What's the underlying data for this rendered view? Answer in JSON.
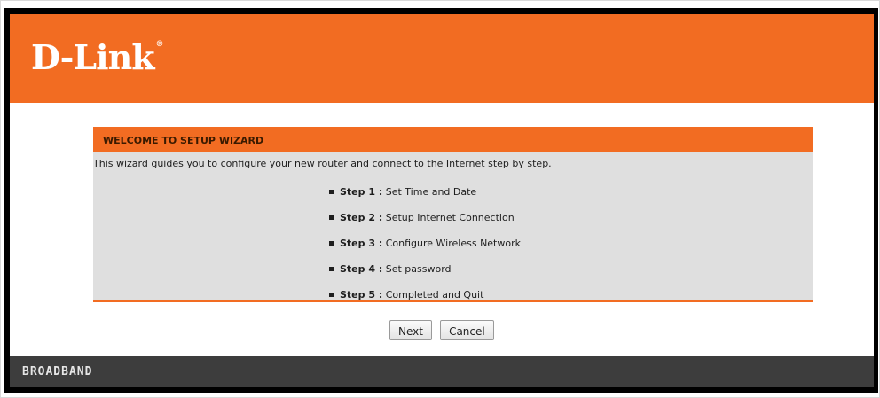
{
  "brand": {
    "logo_text": "D-Link",
    "logo_mark": "®",
    "header_color": "#f26c22",
    "footer_color": "#3d3d3d"
  },
  "wizard": {
    "title": "WELCOME TO SETUP WIZARD",
    "intro": "This wizard guides you to configure your new router and connect to the Internet step by step.",
    "steps": [
      {
        "label": "Step 1 :",
        "text": "Set Time and Date"
      },
      {
        "label": "Step 2 :",
        "text": "Setup Internet Connection"
      },
      {
        "label": "Step 3 :",
        "text": "Configure Wireless Network"
      },
      {
        "label": "Step 4 :",
        "text": "Set password"
      },
      {
        "label": "Step 5 :",
        "text": "Completed and Quit"
      }
    ]
  },
  "buttons": {
    "next_label": "Next",
    "cancel_label": "Cancel"
  },
  "footer": {
    "text": "BROADBAND"
  }
}
